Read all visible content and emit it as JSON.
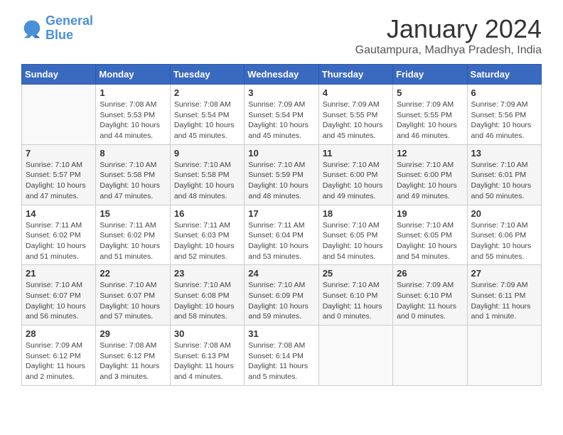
{
  "logo": {
    "line1": "General",
    "line2": "Blue"
  },
  "title": "January 2024",
  "subtitle": "Gautampura, Madhya Pradesh, India",
  "days_of_week": [
    "Sunday",
    "Monday",
    "Tuesday",
    "Wednesday",
    "Thursday",
    "Friday",
    "Saturday"
  ],
  "weeks": [
    [
      {
        "day": "",
        "sunrise": "",
        "sunset": "",
        "daylight": ""
      },
      {
        "day": "1",
        "sunrise": "Sunrise: 7:08 AM",
        "sunset": "Sunset: 5:53 PM",
        "daylight": "Daylight: 10 hours and 44 minutes."
      },
      {
        "day": "2",
        "sunrise": "Sunrise: 7:08 AM",
        "sunset": "Sunset: 5:54 PM",
        "daylight": "Daylight: 10 hours and 45 minutes."
      },
      {
        "day": "3",
        "sunrise": "Sunrise: 7:09 AM",
        "sunset": "Sunset: 5:54 PM",
        "daylight": "Daylight: 10 hours and 45 minutes."
      },
      {
        "day": "4",
        "sunrise": "Sunrise: 7:09 AM",
        "sunset": "Sunset: 5:55 PM",
        "daylight": "Daylight: 10 hours and 45 minutes."
      },
      {
        "day": "5",
        "sunrise": "Sunrise: 7:09 AM",
        "sunset": "Sunset: 5:55 PM",
        "daylight": "Daylight: 10 hours and 46 minutes."
      },
      {
        "day": "6",
        "sunrise": "Sunrise: 7:09 AM",
        "sunset": "Sunset: 5:56 PM",
        "daylight": "Daylight: 10 hours and 46 minutes."
      }
    ],
    [
      {
        "day": "7",
        "sunrise": "Sunrise: 7:10 AM",
        "sunset": "Sunset: 5:57 PM",
        "daylight": "Daylight: 10 hours and 47 minutes."
      },
      {
        "day": "8",
        "sunrise": "Sunrise: 7:10 AM",
        "sunset": "Sunset: 5:58 PM",
        "daylight": "Daylight: 10 hours and 47 minutes."
      },
      {
        "day": "9",
        "sunrise": "Sunrise: 7:10 AM",
        "sunset": "Sunset: 5:58 PM",
        "daylight": "Daylight: 10 hours and 48 minutes."
      },
      {
        "day": "10",
        "sunrise": "Sunrise: 7:10 AM",
        "sunset": "Sunset: 5:59 PM",
        "daylight": "Daylight: 10 hours and 48 minutes."
      },
      {
        "day": "11",
        "sunrise": "Sunrise: 7:10 AM",
        "sunset": "Sunset: 6:00 PM",
        "daylight": "Daylight: 10 hours and 49 minutes."
      },
      {
        "day": "12",
        "sunrise": "Sunrise: 7:10 AM",
        "sunset": "Sunset: 6:00 PM",
        "daylight": "Daylight: 10 hours and 49 minutes."
      },
      {
        "day": "13",
        "sunrise": "Sunrise: 7:10 AM",
        "sunset": "Sunset: 6:01 PM",
        "daylight": "Daylight: 10 hours and 50 minutes."
      }
    ],
    [
      {
        "day": "14",
        "sunrise": "Sunrise: 7:11 AM",
        "sunset": "Sunset: 6:02 PM",
        "daylight": "Daylight: 10 hours and 51 minutes."
      },
      {
        "day": "15",
        "sunrise": "Sunrise: 7:11 AM",
        "sunset": "Sunset: 6:02 PM",
        "daylight": "Daylight: 10 hours and 51 minutes."
      },
      {
        "day": "16",
        "sunrise": "Sunrise: 7:11 AM",
        "sunset": "Sunset: 6:03 PM",
        "daylight": "Daylight: 10 hours and 52 minutes."
      },
      {
        "day": "17",
        "sunrise": "Sunrise: 7:11 AM",
        "sunset": "Sunset: 6:04 PM",
        "daylight": "Daylight: 10 hours and 53 minutes."
      },
      {
        "day": "18",
        "sunrise": "Sunrise: 7:10 AM",
        "sunset": "Sunset: 6:05 PM",
        "daylight": "Daylight: 10 hours and 54 minutes."
      },
      {
        "day": "19",
        "sunrise": "Sunrise: 7:10 AM",
        "sunset": "Sunset: 6:05 PM",
        "daylight": "Daylight: 10 hours and 54 minutes."
      },
      {
        "day": "20",
        "sunrise": "Sunrise: 7:10 AM",
        "sunset": "Sunset: 6:06 PM",
        "daylight": "Daylight: 10 hours and 55 minutes."
      }
    ],
    [
      {
        "day": "21",
        "sunrise": "Sunrise: 7:10 AM",
        "sunset": "Sunset: 6:07 PM",
        "daylight": "Daylight: 10 hours and 56 minutes."
      },
      {
        "day": "22",
        "sunrise": "Sunrise: 7:10 AM",
        "sunset": "Sunset: 6:07 PM",
        "daylight": "Daylight: 10 hours and 57 minutes."
      },
      {
        "day": "23",
        "sunrise": "Sunrise: 7:10 AM",
        "sunset": "Sunset: 6:08 PM",
        "daylight": "Daylight: 10 hours and 58 minutes."
      },
      {
        "day": "24",
        "sunrise": "Sunrise: 7:10 AM",
        "sunset": "Sunset: 6:09 PM",
        "daylight": "Daylight: 10 hours and 59 minutes."
      },
      {
        "day": "25",
        "sunrise": "Sunrise: 7:10 AM",
        "sunset": "Sunset: 6:10 PM",
        "daylight": "Daylight: 11 hours and 0 minutes."
      },
      {
        "day": "26",
        "sunrise": "Sunrise: 7:09 AM",
        "sunset": "Sunset: 6:10 PM",
        "daylight": "Daylight: 11 hours and 0 minutes."
      },
      {
        "day": "27",
        "sunrise": "Sunrise: 7:09 AM",
        "sunset": "Sunset: 6:11 PM",
        "daylight": "Daylight: 11 hours and 1 minute."
      }
    ],
    [
      {
        "day": "28",
        "sunrise": "Sunrise: 7:09 AM",
        "sunset": "Sunset: 6:12 PM",
        "daylight": "Daylight: 11 hours and 2 minutes."
      },
      {
        "day": "29",
        "sunrise": "Sunrise: 7:08 AM",
        "sunset": "Sunset: 6:12 PM",
        "daylight": "Daylight: 11 hours and 3 minutes."
      },
      {
        "day": "30",
        "sunrise": "Sunrise: 7:08 AM",
        "sunset": "Sunset: 6:13 PM",
        "daylight": "Daylight: 11 hours and 4 minutes."
      },
      {
        "day": "31",
        "sunrise": "Sunrise: 7:08 AM",
        "sunset": "Sunset: 6:14 PM",
        "daylight": "Daylight: 11 hours and 5 minutes."
      },
      {
        "day": "",
        "sunrise": "",
        "sunset": "",
        "daylight": ""
      },
      {
        "day": "",
        "sunrise": "",
        "sunset": "",
        "daylight": ""
      },
      {
        "day": "",
        "sunrise": "",
        "sunset": "",
        "daylight": ""
      }
    ]
  ]
}
